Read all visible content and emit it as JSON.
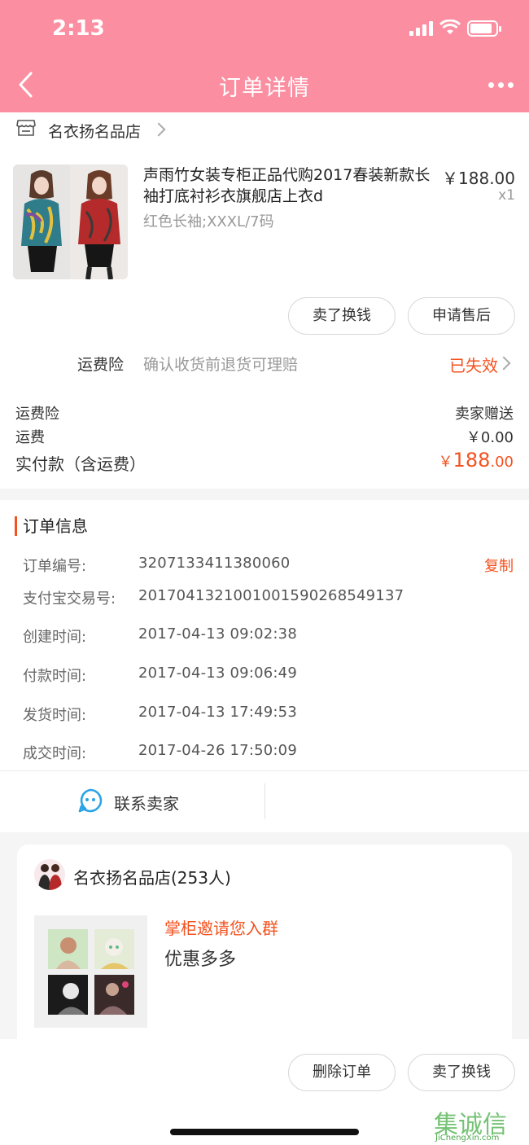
{
  "status": {
    "time": "2:13"
  },
  "nav": {
    "title": "订单详情"
  },
  "shop": {
    "name": "名衣扬名品店"
  },
  "product": {
    "title": "声雨竹女装专柜正品代购2017春装新款长袖打底衬衫衣旗舰店上衣d",
    "price": "￥188.00",
    "qty": "x1",
    "sku": "红色长袖;XXXL/7码"
  },
  "actions": {
    "sell_label": "卖了换钱",
    "after_sale_label": "申请售后"
  },
  "insurance": {
    "label": "运费险",
    "desc": "确认收货前退货可理赔",
    "status": "已失效"
  },
  "summary": {
    "rows": [
      {
        "label": "运费险",
        "value": "卖家赠送"
      },
      {
        "label": "运费",
        "value": "￥0.00"
      }
    ],
    "total_label": "实付款（含运费）",
    "total_currency": "￥",
    "total_int": "188",
    "total_dec": ".00"
  },
  "order_info": {
    "heading": "订单信息",
    "copy_label": "复制",
    "rows": [
      {
        "key": "订单编号:",
        "value": "3207133411380060"
      },
      {
        "key": "支付宝交易号:",
        "value": "2017041321001001590268549137"
      },
      {
        "key": "创建时间:",
        "value": "2017-04-13 09:02:38"
      },
      {
        "key": "付款时间:",
        "value": "2017-04-13 09:06:49"
      },
      {
        "key": "发货时间:",
        "value": "2017-04-13 17:49:53"
      },
      {
        "key": "成交时间:",
        "value": "2017-04-26 17:50:09"
      }
    ]
  },
  "contact": {
    "label": "联系卖家"
  },
  "group": {
    "name": "名衣扬名品店(253人)",
    "invite": "掌柜邀请您入群",
    "promo": "优惠多多"
  },
  "bottom": {
    "delete_label": "删除订单",
    "sell_label": "卖了换钱"
  },
  "watermark": {
    "cn": "集诚信",
    "en": "JiChengXin.com"
  },
  "colors": {
    "brand_pink": "#fc8ea1",
    "accent_orange": "#f4511e"
  }
}
